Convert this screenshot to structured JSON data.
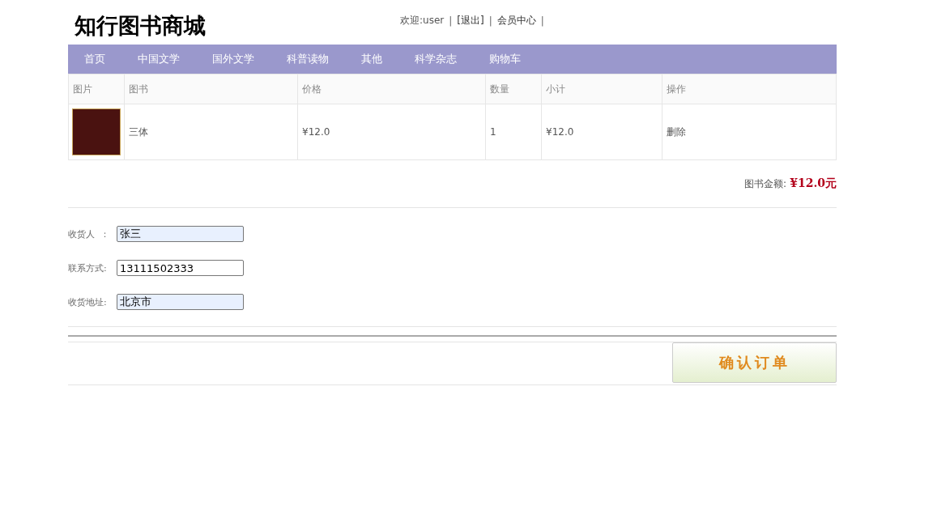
{
  "header": {
    "logo": "知行图书商城",
    "user_links": [
      {
        "kind": "text",
        "label": "欢迎:user"
      },
      {
        "kind": "separator",
        "label": "|"
      },
      {
        "kind": "link",
        "label": "[退出]"
      },
      {
        "kind": "separator",
        "label": "|"
      },
      {
        "kind": "link",
        "label": "会员中心"
      },
      {
        "kind": "separator",
        "label": "|"
      }
    ]
  },
  "nav": [
    "首页",
    "中国文学",
    "国外文学",
    "科普读物",
    "其他",
    "科学杂志",
    "购物车"
  ],
  "cart": {
    "columns": [
      "图片",
      "图书",
      "价格",
      "数量",
      "小计",
      "操作"
    ],
    "rows": [
      {
        "book": "三体",
        "price": "¥12.0",
        "quantity": "1",
        "subtotal": "¥12.0",
        "action": "删除"
      }
    ]
  },
  "total": {
    "label": "图书金额:",
    "amount": "¥12.0元"
  },
  "form": [
    {
      "label": "收货人  ：",
      "value": "张三",
      "autofilled": true
    },
    {
      "label": "联系方式:",
      "value": "13111502333",
      "autofilled": false
    },
    {
      "label": "收货地址:",
      "value": "北京市",
      "autofilled": true
    }
  ],
  "submit": "确认订单"
}
